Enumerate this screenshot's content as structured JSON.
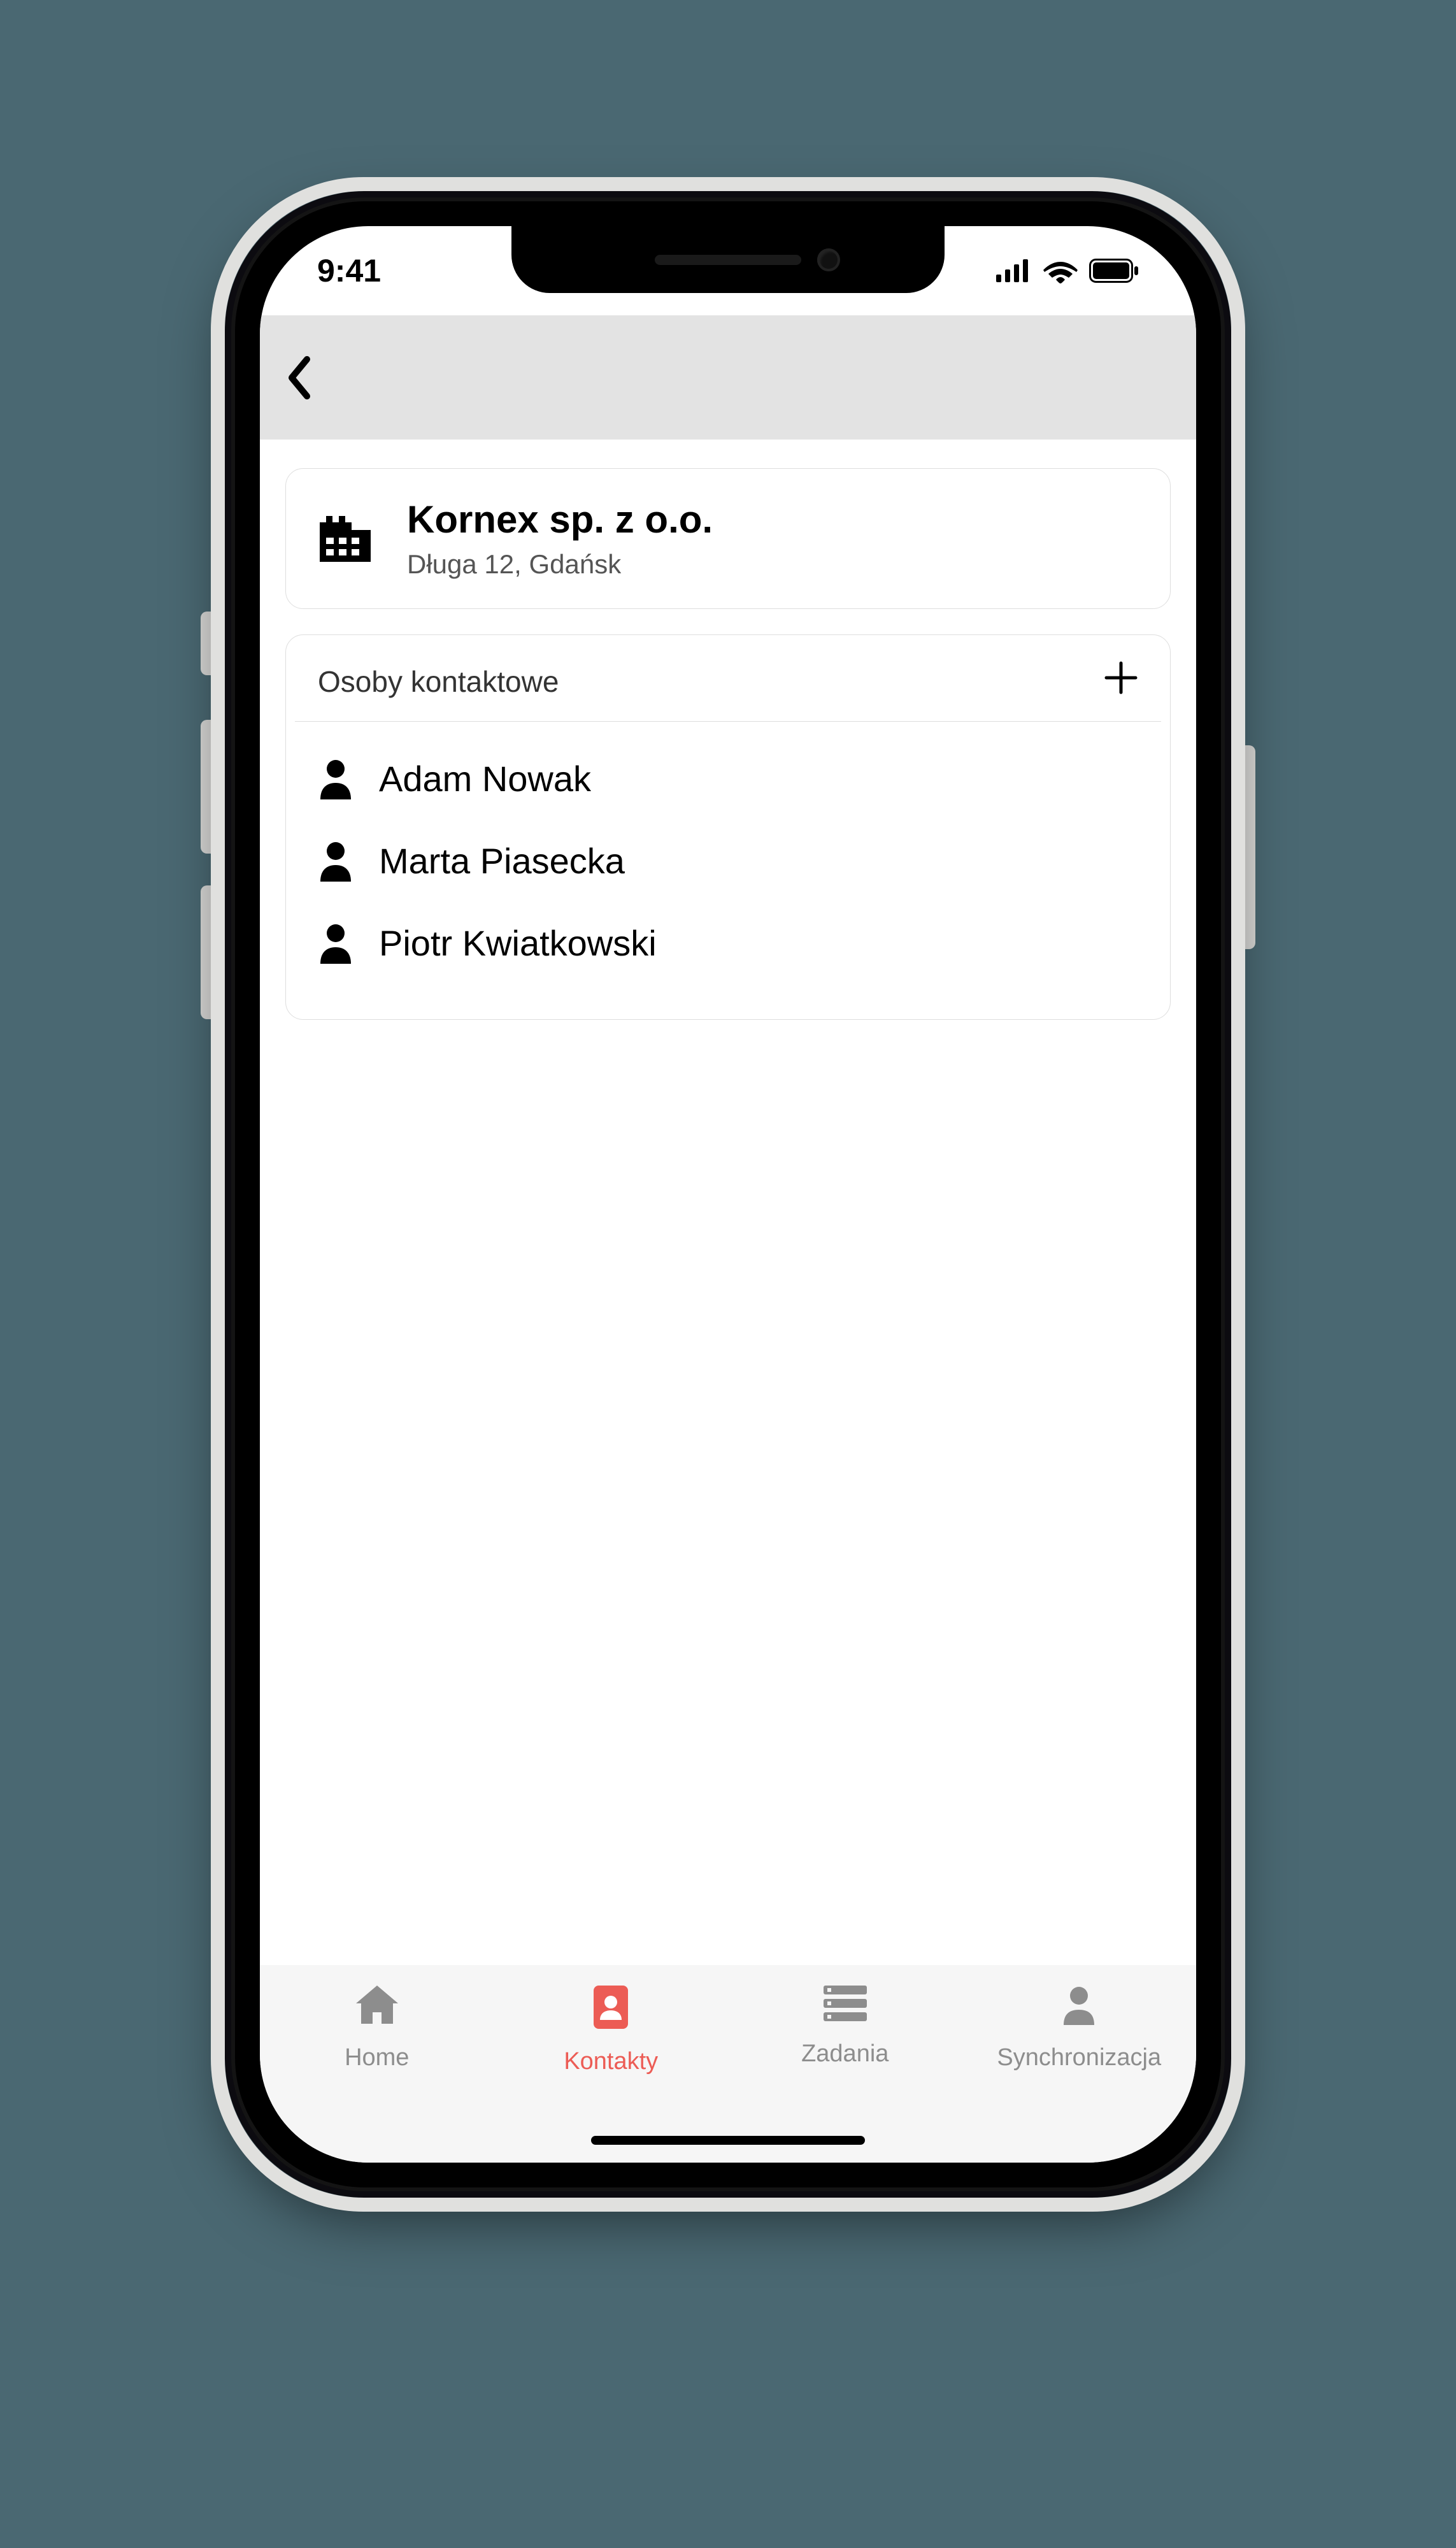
{
  "status": {
    "time": "9:41"
  },
  "company": {
    "name": "Kornex sp. z o.o.",
    "address": "Długa 12, Gdańsk"
  },
  "contacts": {
    "title": "Osoby kontaktowe",
    "people": [
      {
        "name": "Adam Nowak"
      },
      {
        "name": "Marta  Piasecka"
      },
      {
        "name": "Piotr Kwiatkowski"
      }
    ]
  },
  "tabs": {
    "home": "Home",
    "contacts": "Kontakty",
    "tasks": "Zadania",
    "sync": "Synchronizacja",
    "active": "contacts"
  }
}
